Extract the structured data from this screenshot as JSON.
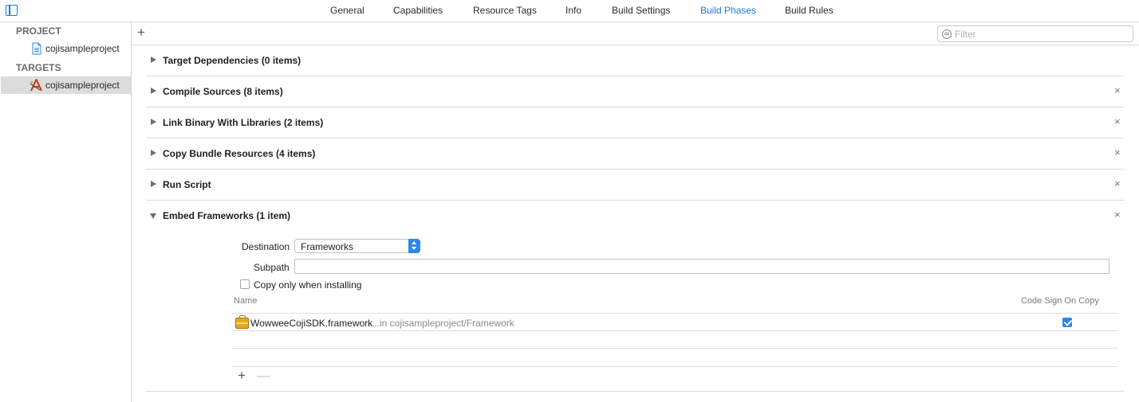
{
  "tabs": [
    {
      "label": "General",
      "active": false
    },
    {
      "label": "Capabilities",
      "active": false
    },
    {
      "label": "Resource Tags",
      "active": false
    },
    {
      "label": "Info",
      "active": false
    },
    {
      "label": "Build Settings",
      "active": false
    },
    {
      "label": "Build Phases",
      "active": true
    },
    {
      "label": "Build Rules",
      "active": false
    }
  ],
  "sidebar": {
    "project_header": "PROJECT",
    "project_item": "cojisampleproject",
    "targets_header": "TARGETS",
    "target_item": "cojisampleproject"
  },
  "toolbar": {
    "add_symbol": "+",
    "filter_placeholder": "Filter"
  },
  "phases": [
    {
      "title": "Target Dependencies (0 items)",
      "expanded": false,
      "closable": false
    },
    {
      "title": "Compile Sources (8 items)",
      "expanded": false,
      "closable": true
    },
    {
      "title": "Link Binary With Libraries (2 items)",
      "expanded": false,
      "closable": true
    },
    {
      "title": "Copy Bundle Resources (4 items)",
      "expanded": false,
      "closable": true
    },
    {
      "title": "Run Script",
      "expanded": false,
      "closable": true
    },
    {
      "title": "Embed Frameworks (1 item)",
      "expanded": true,
      "closable": true
    }
  ],
  "close_symbol": "×",
  "embed": {
    "destination_label": "Destination",
    "destination_value": "Frameworks",
    "subpath_label": "Subpath",
    "subpath_value": "",
    "copy_only_label": "Copy only when installing",
    "copy_only_checked": false,
    "columns": {
      "name": "Name",
      "code_sign": "Code Sign On Copy"
    },
    "rows": [
      {
        "name": "WowweeCojiSDK.framework",
        "path": "...in cojisampleproject/Framework",
        "code_sign": true
      }
    ],
    "add_symbol": "+",
    "remove_symbol": "—"
  },
  "colors": {
    "accent": "#1a7ae0",
    "checkbox": "#2e86ef",
    "framework_icon": "#e6a91b"
  }
}
